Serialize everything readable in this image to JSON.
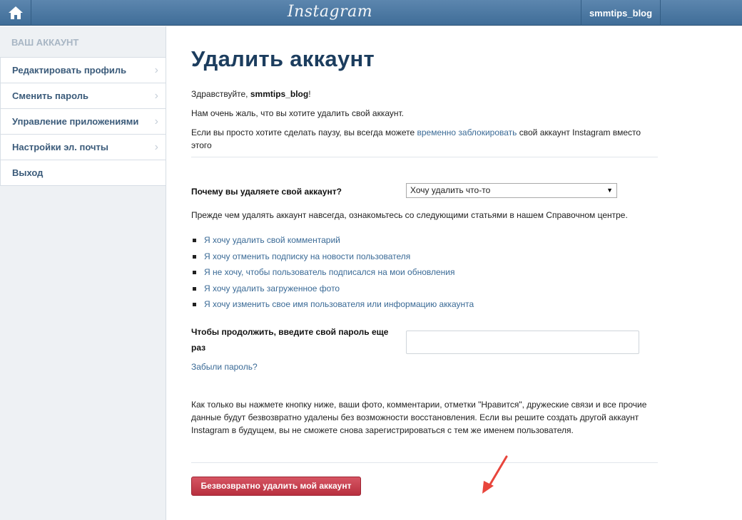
{
  "topbar": {
    "logo": "Instagram",
    "username": "smmtips_blog"
  },
  "sidebar": {
    "title": "ВАШ АККАУНТ",
    "items": [
      {
        "label": "Редактировать профиль",
        "chevron": true
      },
      {
        "label": "Сменить пароль",
        "chevron": true
      },
      {
        "label": "Управление приложениями",
        "chevron": true
      },
      {
        "label": "Настройки эл. почты",
        "chevron": true
      },
      {
        "label": "Выход",
        "chevron": false
      }
    ]
  },
  "main": {
    "title": "Удалить аккаунт",
    "greeting_prefix": "Здравствуйте, ",
    "greeting_user": "smmtips_blog",
    "greeting_suffix": "!",
    "sorry": "Нам очень жаль, что вы хотите удалить свой аккаунт.",
    "pause_prefix": "Если вы просто хотите сделать паузу, вы всегда можете ",
    "pause_link": "временно заблокировать",
    "pause_suffix": " свой аккаунт Instagram вместо этого",
    "reason_label": "Почему вы удаляете свой аккаунт?",
    "reason_value": "Хочу удалить что-то",
    "help_intro": "Прежде чем удалять аккаунт навсегда, ознакомьтесь со следующими статьями в нашем Справочном центре.",
    "help_links": [
      "Я хочу удалить свой комментарий",
      "Я хочу отменить подписку на новости пользователя",
      "Я не хочу, чтобы пользователь подписался на мои обновления",
      "Я хочу удалить загруженное фото",
      "Я хочу изменить свое имя пользователя или информацию аккаунта"
    ],
    "password_label": "Чтобы продолжить, введите свой пароль еще раз",
    "password_value": "",
    "forgot_link": "Забыли пароль?",
    "warning": "Как только вы нажмете кнопку ниже, ваши фото, комментарии, отметки \"Нравится\", дружеские связи и все прочие данные будут безвозвратно удалены без возможности восстановления. Если вы решите создать другой аккаунт Instagram в будущем, вы не сможете снова зарегистрироваться с тем же именем пользователя.",
    "delete_button": "Безвозвратно удалить мой аккаунт"
  },
  "colors": {
    "topbar": "#4f7aa3",
    "link": "#3a6a96",
    "title": "#1c3d5e",
    "delete_button": "#c73e4d",
    "annotation_arrow": "#e8453c"
  }
}
